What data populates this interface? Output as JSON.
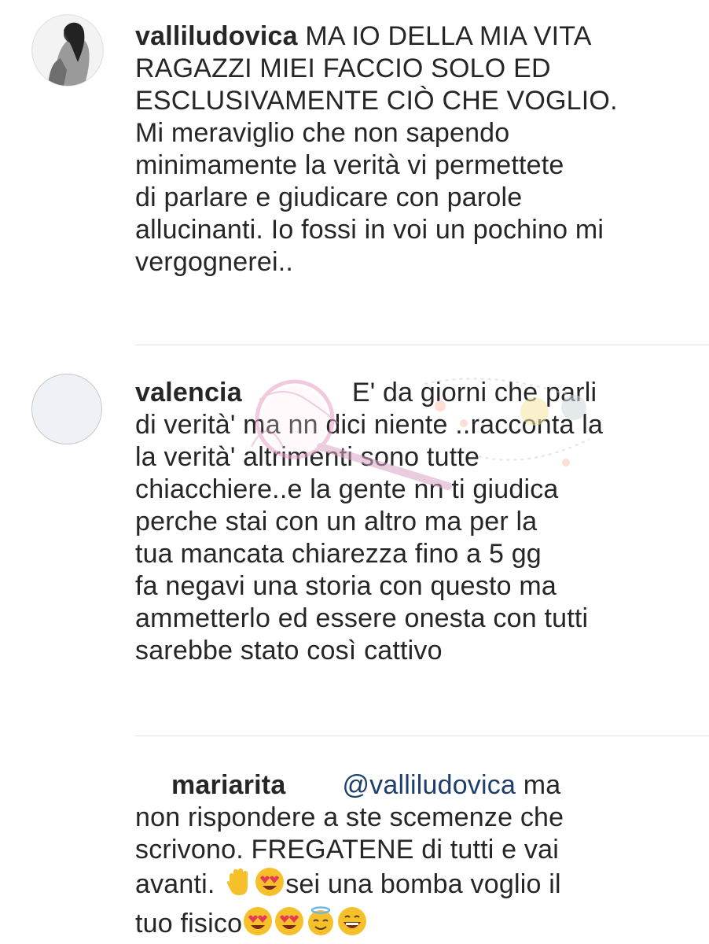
{
  "comments": [
    {
      "username": "valliludovica",
      "text": "MA IO DELLA MIA VITA\nRAGAZZI MIEI FACCIO SOLO ED\nESCLUSIVAMENTE CIÒ CHE VOGLIO.\nMi meraviglio che non sapendo\nminimamente la verità vi permettete\ndi parlare e giudicare con parole\nallucinanti. Io fossi in voi un pochino mi\nvergognerei..",
      "avatar": "profile-photo"
    },
    {
      "username": "valencia",
      "text_first": "E' da giorni che parli",
      "text": "di verità' ma nn dici niente ..racconta la\nla verità' altrimenti sono tutte\nchiacchiere..e la gente nn ti giudica\nperche stai con un altro ma per la\ntua mancata chiarezza fino a 5 gg\nfa negavi una storia con questo ma\nammetterlo ed essere onesta con tutti\nsarebbe stato così cattivo",
      "avatar": "empty"
    },
    {
      "username": "mariarita",
      "mention": "@valliludovica",
      "text_first": "ma",
      "text": "non rispondere a ste scemenze che\nscrivono. FREGATENE di tutti e vai",
      "text_line4_a": "avanti.",
      "text_line4_b": "sei una bomba voglio il",
      "text_line5": "tuo fisico"
    }
  ],
  "emojis": {
    "raised_hand": "✋",
    "heart_eyes": "😍",
    "halo": "😇",
    "smile": "😄"
  },
  "colors": {
    "text": "#262626",
    "mention": "#1e3f6e",
    "divider": "#e2e2e2",
    "emoji_yellow": "#f5c02a"
  }
}
